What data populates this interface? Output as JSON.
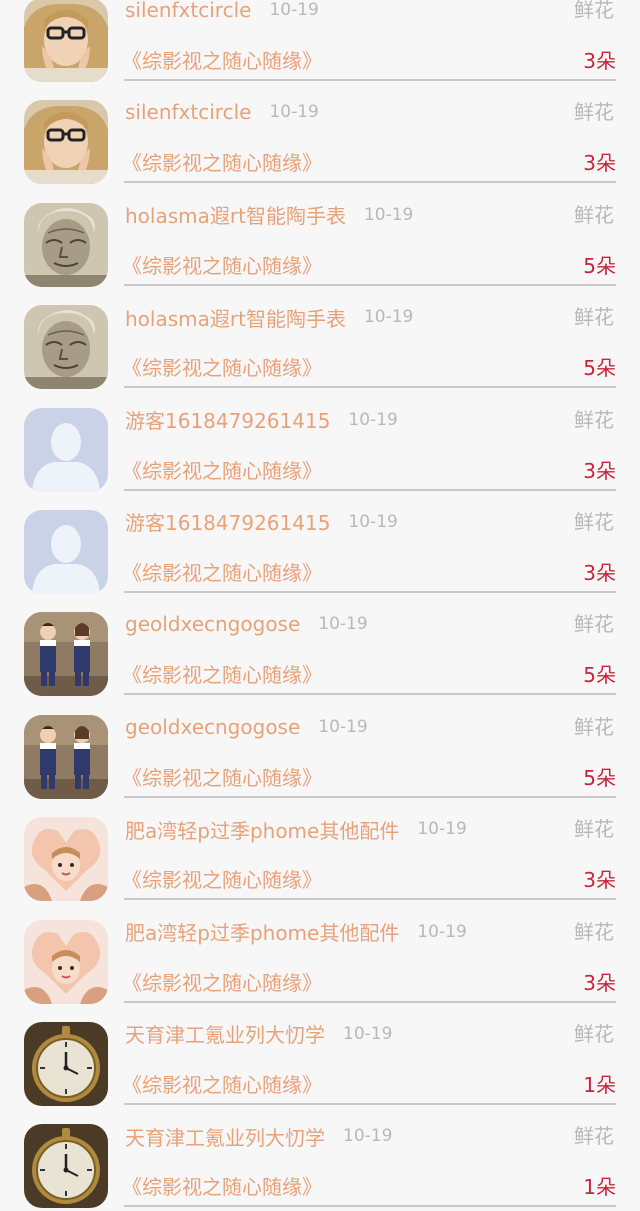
{
  "colors": {
    "name": "#e8a27a",
    "date": "#b8b8b8",
    "count": "#c8243c",
    "background": "#f7f7f7"
  },
  "records": [
    {
      "avatar": "blonde-girl-glasses",
      "name": "silenfxtcircle",
      "date": "10-19",
      "gift": "鲜花",
      "work": "《综影视之随心随缘》",
      "count": "3朵"
    },
    {
      "avatar": "blonde-girl-glasses",
      "name": "silenfxtcircle",
      "date": "10-19",
      "gift": "鲜花",
      "work": "《综影视之随心随缘》",
      "count": "3朵"
    },
    {
      "avatar": "old-man-sketch",
      "name": "holasma遐rt智能陶手表",
      "date": "10-19",
      "gift": "鲜花",
      "work": "《综影视之随心随缘》",
      "count": "5朵"
    },
    {
      "avatar": "old-man-sketch",
      "name": "holasma遐rt智能陶手表",
      "date": "10-19",
      "gift": "鲜花",
      "work": "《综影视之随心随缘》",
      "count": "5朵"
    },
    {
      "avatar": "default-user",
      "name": "游客1618479261415",
      "date": "10-19",
      "gift": "鲜花",
      "work": "《综影视之随心随缘》",
      "count": "3朵"
    },
    {
      "avatar": "default-user",
      "name": "游客1618479261415",
      "date": "10-19",
      "gift": "鲜花",
      "work": "《综影视之随心随缘》",
      "count": "3朵"
    },
    {
      "avatar": "kids-overalls",
      "name": "geoldxecngogose",
      "date": "10-19",
      "gift": "鲜花",
      "work": "《综影视之随心随缘》",
      "count": "5朵"
    },
    {
      "avatar": "kids-overalls",
      "name": "geoldxecngogose",
      "date": "10-19",
      "gift": "鲜花",
      "work": "《综影视之随心随缘》",
      "count": "5朵"
    },
    {
      "avatar": "girl-heart-hands",
      "name": "肥a湾轻p过季phome其他配件",
      "date": "10-19",
      "gift": "鲜花",
      "work": "《综影视之随心随缘》",
      "count": "3朵"
    },
    {
      "avatar": "girl-heart-hands",
      "name": "肥a湾轻p过季phome其他配件",
      "date": "10-19",
      "gift": "鲜花",
      "work": "《综影视之随心随缘》",
      "count": "3朵"
    },
    {
      "avatar": "pocket-watch",
      "name": "天育津工氪业列大忉学",
      "date": "10-19",
      "gift": "鲜花",
      "work": "《综影视之随心随缘》",
      "count": "1朵"
    },
    {
      "avatar": "pocket-watch",
      "name": "天育津工氪业列大忉学",
      "date": "10-19",
      "gift": "鲜花",
      "work": "《综影视之随心随缘》",
      "count": "1朵"
    }
  ]
}
